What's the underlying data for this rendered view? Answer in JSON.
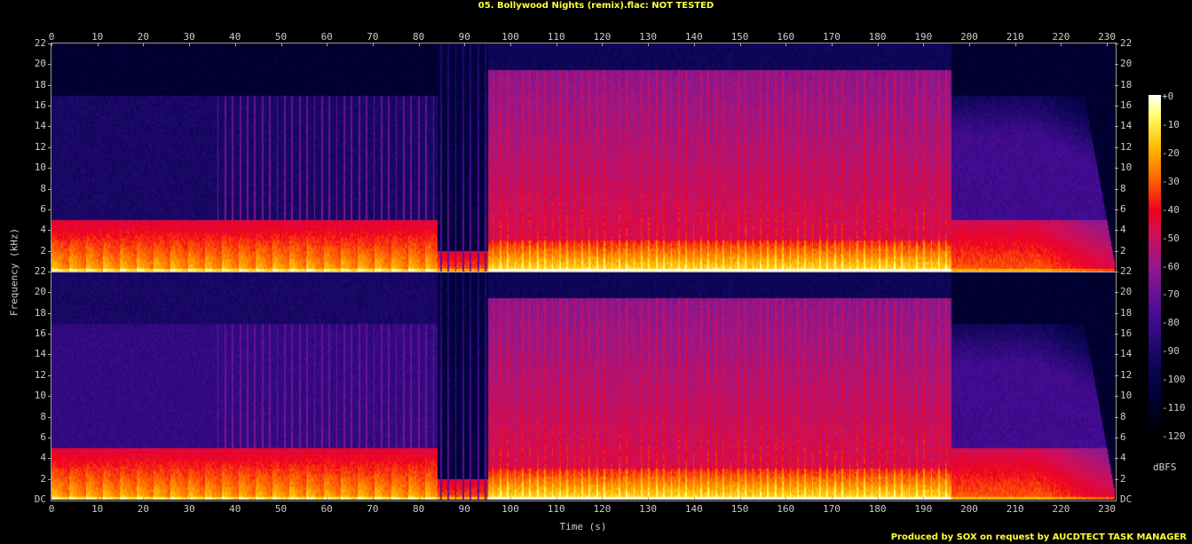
{
  "title": "05. Bollywood Nights (remix).flac: NOT TESTED",
  "footer": "Produced by SOX on request by AUCDTECT TASK MANAGER",
  "chart_data": {
    "type": "heatmap",
    "subtype": "spectrogram",
    "channels": 2,
    "xlabel": "Time (s)",
    "ylabel": "Frequency (kHz)",
    "xlim": [
      0,
      231.7
    ],
    "ylim": [
      0,
      22
    ],
    "x_ticks": [
      0,
      10,
      20,
      30,
      40,
      50,
      60,
      70,
      80,
      90,
      100,
      110,
      120,
      130,
      140,
      150,
      160,
      170,
      180,
      190,
      200,
      210,
      220,
      230
    ],
    "y_ticks": [
      2,
      4,
      6,
      8,
      10,
      12,
      14,
      16,
      18,
      20,
      22
    ],
    "y_zero_label": "DC",
    "colorbar": {
      "label": "dBFS",
      "range": [
        -120,
        0
      ],
      "ticks": [
        "+0",
        "-10",
        "-20",
        "-30",
        "-40",
        "-50",
        "-60",
        "-70",
        "-80",
        "-90",
        "-100",
        "-110",
        "-120"
      ]
    },
    "segments": [
      {
        "start": 0,
        "end": 36,
        "cutoff_khz": 17,
        "level": "low",
        "beats": false
      },
      {
        "start": 36,
        "end": 84,
        "cutoff_khz": 17,
        "level": "low",
        "beats": true
      },
      {
        "start": 84,
        "end": 95,
        "cutoff_khz": 22,
        "level": "sparse",
        "beats": true
      },
      {
        "start": 95,
        "end": 196,
        "cutoff_khz": 19.5,
        "level": "high",
        "beats": true
      },
      {
        "start": 196,
        "end": 231.7,
        "cutoff_khz": 17,
        "level": "fade",
        "beats": false
      }
    ]
  }
}
